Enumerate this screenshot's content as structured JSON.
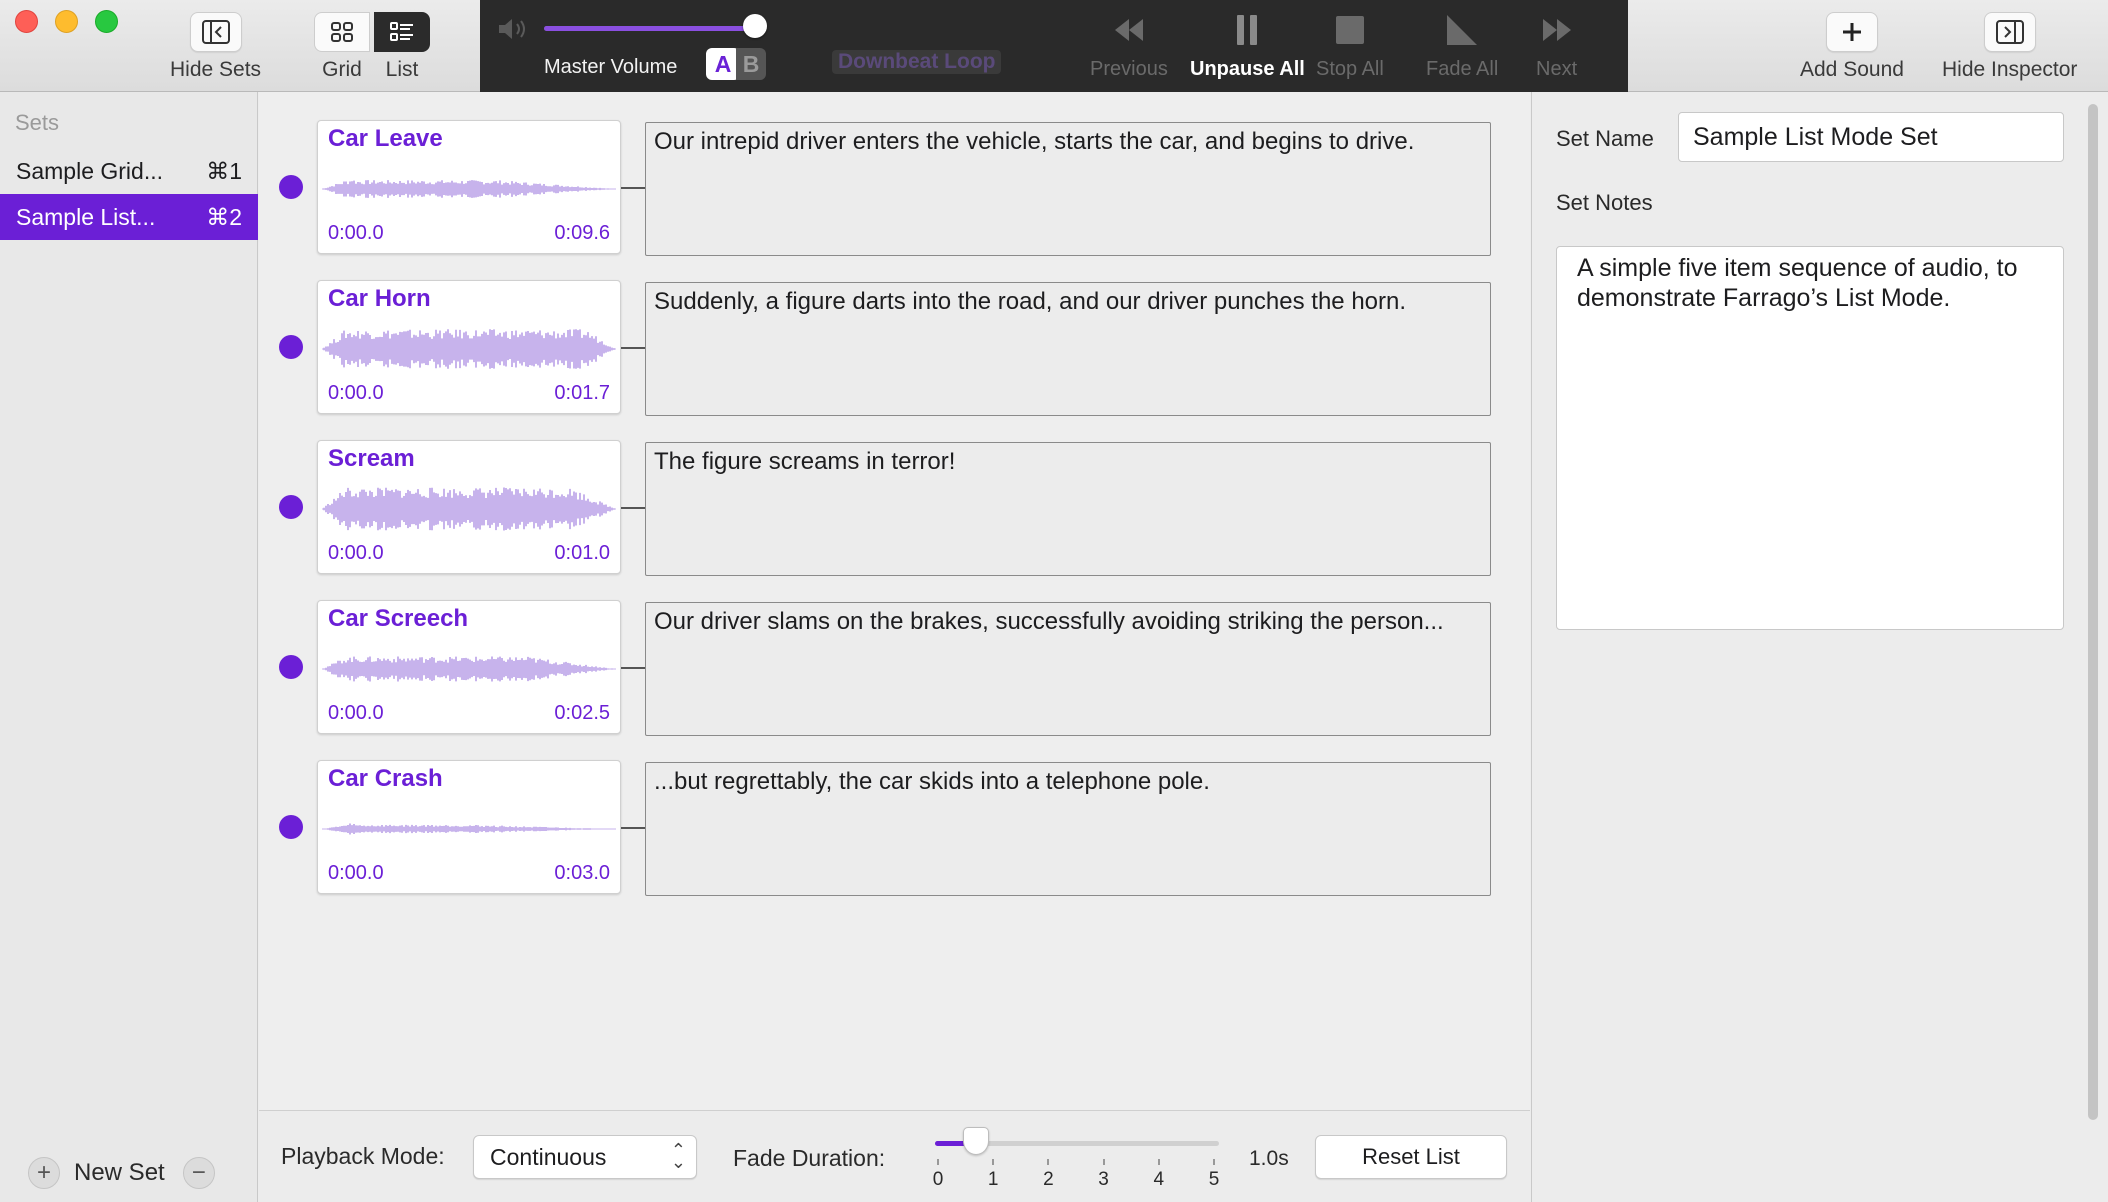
{
  "toolbar": {
    "hide_sets": "Hide Sets",
    "grid": "Grid",
    "list": "List",
    "master_volume": "Master Volume",
    "master_volume_level": 0.95,
    "ab_a": "A",
    "ab_b": "B",
    "now_playing": "Downbeat Loop",
    "previous": "Previous",
    "unpause_all": "Unpause All",
    "stop_all": "Stop All",
    "fade_all": "Fade All",
    "next": "Next",
    "add_sound": "Add Sound",
    "hide_inspector": "Hide Inspector"
  },
  "sidebar": {
    "header": "Sets",
    "sets": [
      {
        "name": "Sample Grid...",
        "shortcut": "⌘1",
        "selected": false
      },
      {
        "name": "Sample List...",
        "shortcut": "⌘2",
        "selected": true
      }
    ],
    "new_set": "New Set",
    "add_symbol": "+",
    "remove_symbol": "−"
  },
  "list": {
    "items": [
      {
        "title": "Car Leave",
        "start": "0:00.0",
        "end": "0:09.6",
        "note": "Our intrepid driver enters the vehicle, starts the car, and begins to drive."
      },
      {
        "title": "Car Horn",
        "start": "0:00.0",
        "end": "0:01.7",
        "note": "Suddenly, a figure darts into the road, and our driver punches the horn."
      },
      {
        "title": "Scream",
        "start": "0:00.0",
        "end": "0:01.0",
        "note": "The figure screams in terror!"
      },
      {
        "title": "Car Screech",
        "start": "0:00.0",
        "end": "0:02.5",
        "note": "Our driver slams on the brakes, successfully avoiding striking the person..."
      },
      {
        "title": "Car Crash",
        "start": "0:00.0",
        "end": "0:03.0",
        "note": "...but regrettably, the car skids into a telephone pole."
      }
    ]
  },
  "bottom": {
    "playback_mode_label": "Playback Mode:",
    "playback_mode_value": "Continuous",
    "fade_duration_label": "Fade Duration:",
    "fade_ticks": [
      "0",
      "1",
      "2",
      "3",
      "4",
      "5"
    ],
    "fade_min": 0,
    "fade_max": 5,
    "fade_current": 1.0,
    "fade_value": "1.0s",
    "reset_list": "Reset List"
  },
  "inspector": {
    "set_name_label": "Set Name",
    "set_name_value": "Sample List Mode Set",
    "set_notes_label": "Set Notes",
    "set_notes_value": "A simple five item sequence of audio, to demonstrate Farrago’s List Mode."
  },
  "colors": {
    "accent": "#6b1fd6",
    "waveform": "#c7b3ec",
    "toolbar_dark": "#2a2a2a"
  }
}
